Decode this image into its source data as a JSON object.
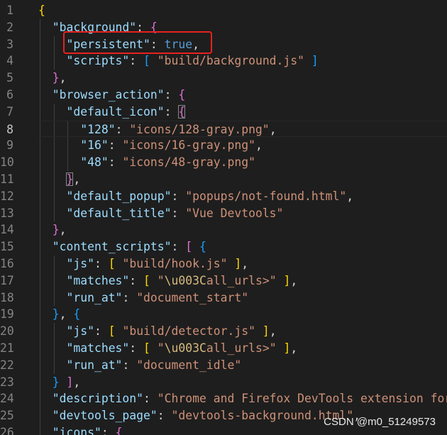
{
  "editor": {
    "lines": [
      {
        "n": "1",
        "tokens": [
          {
            "t": "{",
            "c": "y"
          }
        ]
      },
      {
        "n": "2",
        "tokens": [
          {
            "t": "  "
          },
          {
            "t": "\"background\"",
            "c": "k"
          },
          {
            "t": ": "
          },
          {
            "t": "{",
            "c": "pu"
          }
        ]
      },
      {
        "n": "3",
        "tokens": [
          {
            "t": "    "
          },
          {
            "t": "\"persistent\"",
            "c": "k"
          },
          {
            "t": ": "
          },
          {
            "t": "true",
            "c": "b"
          },
          {
            "t": ","
          }
        ]
      },
      {
        "n": "4",
        "tokens": [
          {
            "t": "    "
          },
          {
            "t": "\"scripts\"",
            "c": "k"
          },
          {
            "t": ": "
          },
          {
            "t": "[",
            "c": "bl"
          },
          {
            "t": " "
          },
          {
            "t": "\"build/background.js\"",
            "c": "s"
          },
          {
            "t": " "
          },
          {
            "t": "]",
            "c": "bl"
          }
        ]
      },
      {
        "n": "5",
        "tokens": [
          {
            "t": "  "
          },
          {
            "t": "}",
            "c": "pu"
          },
          {
            "t": ","
          }
        ]
      },
      {
        "n": "6",
        "tokens": [
          {
            "t": "  "
          },
          {
            "t": "\"browser_action\"",
            "c": "k"
          },
          {
            "t": ": "
          },
          {
            "t": "{",
            "c": "pu"
          }
        ]
      },
      {
        "n": "7",
        "tokens": [
          {
            "t": "    "
          },
          {
            "t": "\"default_icon\"",
            "c": "k"
          },
          {
            "t": ": "
          },
          {
            "t": "{",
            "c": "bl",
            "m": true
          }
        ]
      },
      {
        "n": "8",
        "tokens": [
          {
            "t": "      "
          },
          {
            "t": "\"128\"",
            "c": "k"
          },
          {
            "t": ": "
          },
          {
            "t": "\"icons/128-gray.png\"",
            "c": "s"
          },
          {
            "t": ","
          }
        ],
        "current": true
      },
      {
        "n": "9",
        "tokens": [
          {
            "t": "      "
          },
          {
            "t": "\"16\"",
            "c": "k"
          },
          {
            "t": ": "
          },
          {
            "t": "\"icons/16-gray.png\"",
            "c": "s"
          },
          {
            "t": ","
          }
        ]
      },
      {
        "n": "10",
        "tokens": [
          {
            "t": "      "
          },
          {
            "t": "\"48\"",
            "c": "k"
          },
          {
            "t": ": "
          },
          {
            "t": "\"icons/48-gray.png\"",
            "c": "s"
          }
        ]
      },
      {
        "n": "11",
        "tokens": [
          {
            "t": "    "
          },
          {
            "t": "}",
            "c": "bl",
            "m": true
          },
          {
            "t": ","
          }
        ]
      },
      {
        "n": "12",
        "tokens": [
          {
            "t": "    "
          },
          {
            "t": "\"default_popup\"",
            "c": "k"
          },
          {
            "t": ": "
          },
          {
            "t": "\"popups/not-found.html\"",
            "c": "s"
          },
          {
            "t": ","
          }
        ]
      },
      {
        "n": "13",
        "tokens": [
          {
            "t": "    "
          },
          {
            "t": "\"default_title\"",
            "c": "k"
          },
          {
            "t": ": "
          },
          {
            "t": "\"Vue Devtools\"",
            "c": "s"
          }
        ]
      },
      {
        "n": "14",
        "tokens": [
          {
            "t": "  "
          },
          {
            "t": "}",
            "c": "pu"
          },
          {
            "t": ","
          }
        ]
      },
      {
        "n": "15",
        "tokens": [
          {
            "t": "  "
          },
          {
            "t": "\"content_scripts\"",
            "c": "k"
          },
          {
            "t": ": "
          },
          {
            "t": "[",
            "c": "pu"
          },
          {
            "t": " "
          },
          {
            "t": "{",
            "c": "bl"
          }
        ]
      },
      {
        "n": "16",
        "tokens": [
          {
            "t": "    "
          },
          {
            "t": "\"js\"",
            "c": "k"
          },
          {
            "t": ": "
          },
          {
            "t": "[",
            "c": "y"
          },
          {
            "t": " "
          },
          {
            "t": "\"build/hook.js\"",
            "c": "s"
          },
          {
            "t": " "
          },
          {
            "t": "]",
            "c": "y"
          },
          {
            "t": ","
          }
        ]
      },
      {
        "n": "17",
        "tokens": [
          {
            "t": "    "
          },
          {
            "t": "\"matches\"",
            "c": "k"
          },
          {
            "t": ": "
          },
          {
            "t": "[",
            "c": "y"
          },
          {
            "t": " "
          },
          {
            "t": "\"",
            "c": "s"
          },
          {
            "t": "\\u003C",
            "c": "esc"
          },
          {
            "t": "all_urls>\"",
            "c": "s"
          },
          {
            "t": " "
          },
          {
            "t": "]",
            "c": "y"
          },
          {
            "t": ","
          }
        ]
      },
      {
        "n": "18",
        "tokens": [
          {
            "t": "    "
          },
          {
            "t": "\"run_at\"",
            "c": "k"
          },
          {
            "t": ": "
          },
          {
            "t": "\"document_start\"",
            "c": "s"
          }
        ]
      },
      {
        "n": "19",
        "tokens": [
          {
            "t": "  "
          },
          {
            "t": "}",
            "c": "bl"
          },
          {
            "t": ", "
          },
          {
            "t": "{",
            "c": "bl"
          }
        ]
      },
      {
        "n": "20",
        "tokens": [
          {
            "t": "    "
          },
          {
            "t": "\"js\"",
            "c": "k"
          },
          {
            "t": ": "
          },
          {
            "t": "[",
            "c": "y"
          },
          {
            "t": " "
          },
          {
            "t": "\"build/detector.js\"",
            "c": "s"
          },
          {
            "t": " "
          },
          {
            "t": "]",
            "c": "y"
          },
          {
            "t": ","
          }
        ]
      },
      {
        "n": "21",
        "tokens": [
          {
            "t": "    "
          },
          {
            "t": "\"matches\"",
            "c": "k"
          },
          {
            "t": ": "
          },
          {
            "t": "[",
            "c": "y"
          },
          {
            "t": " "
          },
          {
            "t": "\"",
            "c": "s"
          },
          {
            "t": "\\u003C",
            "c": "esc"
          },
          {
            "t": "all_urls>\"",
            "c": "s"
          },
          {
            "t": " "
          },
          {
            "t": "]",
            "c": "y"
          },
          {
            "t": ","
          }
        ]
      },
      {
        "n": "22",
        "tokens": [
          {
            "t": "    "
          },
          {
            "t": "\"run_at\"",
            "c": "k"
          },
          {
            "t": ": "
          },
          {
            "t": "\"document_idle\"",
            "c": "s"
          }
        ]
      },
      {
        "n": "23",
        "tokens": [
          {
            "t": "  "
          },
          {
            "t": "}",
            "c": "bl"
          },
          {
            "t": " "
          },
          {
            "t": "]",
            "c": "pu"
          },
          {
            "t": ","
          }
        ]
      },
      {
        "n": "24",
        "tokens": [
          {
            "t": "  "
          },
          {
            "t": "\"description\"",
            "c": "k"
          },
          {
            "t": ": "
          },
          {
            "t": "\"Chrome and Firefox DevTools extension for",
            "c": "s"
          }
        ]
      },
      {
        "n": "25",
        "tokens": [
          {
            "t": "  "
          },
          {
            "t": "\"devtools_page\"",
            "c": "k"
          },
          {
            "t": ": "
          },
          {
            "t": "\"devtools-background.html\"",
            "c": "s"
          },
          {
            "t": ","
          }
        ]
      },
      {
        "n": "26",
        "tokens": [
          {
            "t": "  "
          },
          {
            "t": "\"icons\"",
            "c": "k"
          },
          {
            "t": ": "
          },
          {
            "t": "{",
            "c": "pu"
          }
        ]
      }
    ]
  },
  "watermark": "CSDN @m0_51249573",
  "colors": {
    "background": "#1e1e1e",
    "key": "#9cdcfe",
    "string": "#ce9178",
    "boolean": "#569cd6",
    "highlight": "#e8211e"
  }
}
